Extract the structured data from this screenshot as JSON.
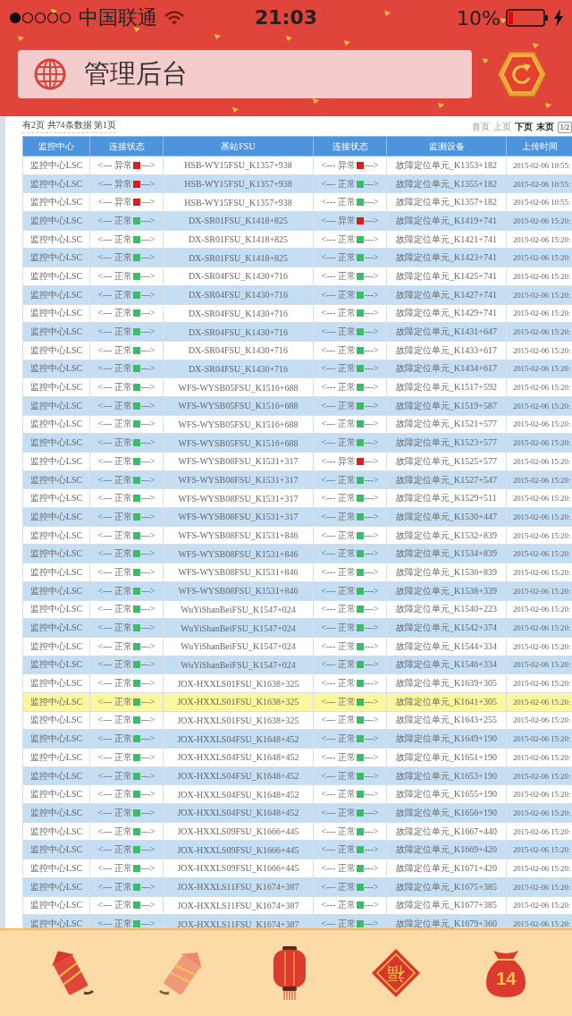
{
  "status_bar": {
    "carrier": "中国联通",
    "time": "21:03",
    "battery": "10%"
  },
  "header": {
    "title": "管理后台"
  },
  "pager": {
    "summary": "有2页 共74条数据 第1页",
    "links": [
      {
        "label": "首页",
        "disabled": true
      },
      {
        "label": "上页",
        "disabled": true
      },
      {
        "label": "下页",
        "disabled": false
      },
      {
        "label": "末页",
        "disabled": false
      }
    ],
    "page_box": "1/2"
  },
  "table": {
    "columns": [
      "监控中心",
      "连接状态",
      "基站FSU",
      "连接状态",
      "监测设备",
      "上传时间"
    ],
    "rows": [
      {
        "center": "监控中心LSC",
        "link_1": {
          "left": "<--- 异常",
          "alarm": true,
          "right": "--->"
        },
        "fsu": "HSB-WY15FSU_K1357+938",
        "link_2": {
          "left": "<--- 异常",
          "alarm": true,
          "right": "--->"
        },
        "device": "故障定位单元_K1353+182",
        "time": "2015-02-06 10:55:",
        "selected": false
      },
      {
        "center": "监控中心LSC",
        "link_1": {
          "left": "<--- 异常",
          "alarm": true,
          "right": "--->"
        },
        "fsu": "HSB-WY15FSU_K1357+938",
        "link_2": {
          "left": "<--- 正常",
          "alarm": false,
          "right": "--->"
        },
        "device": "故障定位单元_K1355+182",
        "time": "2015-02-06 10:55:",
        "selected": false
      },
      {
        "center": "监控中心LSC",
        "link_1": {
          "left": "<--- 异常",
          "alarm": true,
          "right": "--->"
        },
        "fsu": "HSB-WY15FSU_K1357+938",
        "link_2": {
          "left": "<--- 正常",
          "alarm": false,
          "right": "--->"
        },
        "device": "故障定位单元_K1357+182",
        "time": "2015-02-06 10:55:",
        "selected": false
      },
      {
        "center": "监控中心LSC",
        "link_1": {
          "left": "<--- 正常",
          "alarm": false,
          "right": "--->"
        },
        "fsu": "DX-SR01FSU_K1418+825",
        "link_2": {
          "left": "<--- 异常",
          "alarm": true,
          "right": "--->"
        },
        "device": "故障定位单元_K1419+741",
        "time": "2015-02-06 15:20:",
        "selected": false
      },
      {
        "center": "监控中心LSC",
        "link_1": {
          "left": "<--- 正常",
          "alarm": false,
          "right": "--->"
        },
        "fsu": "DX-SR01FSU_K1418+825",
        "link_2": {
          "left": "<--- 正常",
          "alarm": false,
          "right": "--->"
        },
        "device": "故障定位单元_K1421+741",
        "time": "2015-02-06 15:20:",
        "selected": false
      },
      {
        "center": "监控中心LSC",
        "link_1": {
          "left": "<--- 正常",
          "alarm": false,
          "right": "--->"
        },
        "fsu": "DX-SR01FSU_K1418+825",
        "link_2": {
          "left": "<--- 正常",
          "alarm": false,
          "right": "--->"
        },
        "device": "故障定位单元_K1423+741",
        "time": "2015-02-06 15:20:",
        "selected": false
      },
      {
        "center": "监控中心LSC",
        "link_1": {
          "left": "<--- 正常",
          "alarm": false,
          "right": "--->"
        },
        "fsu": "DX-SR04FSU_K1430+716",
        "link_2": {
          "left": "<--- 正常",
          "alarm": false,
          "right": "--->"
        },
        "device": "故障定位单元_K1425+741",
        "time": "2015-02-06 15:20:",
        "selected": false
      },
      {
        "center": "监控中心LSC",
        "link_1": {
          "left": "<--- 正常",
          "alarm": false,
          "right": "--->"
        },
        "fsu": "DX-SR04FSU_K1430+716",
        "link_2": {
          "left": "<--- 正常",
          "alarm": false,
          "right": "--->"
        },
        "device": "故障定位单元_K1427+741",
        "time": "2015-02-06 15:20:",
        "selected": false
      },
      {
        "center": "监控中心LSC",
        "link_1": {
          "left": "<--- 正常",
          "alarm": false,
          "right": "--->"
        },
        "fsu": "DX-SR04FSU_K1430+716",
        "link_2": {
          "left": "<--- 正常",
          "alarm": false,
          "right": "--->"
        },
        "device": "故障定位单元_K1429+741",
        "time": "2015-02-06 15:20:",
        "selected": false
      },
      {
        "center": "监控中心LSC",
        "link_1": {
          "left": "<--- 正常",
          "alarm": false,
          "right": "--->"
        },
        "fsu": "DX-SR04FSU_K1430+716",
        "link_2": {
          "left": "<--- 正常",
          "alarm": false,
          "right": "--->"
        },
        "device": "故障定位单元_K1431+647",
        "time": "2015-02-06 15:20:",
        "selected": false
      },
      {
        "center": "监控中心LSC",
        "link_1": {
          "left": "<--- 正常",
          "alarm": false,
          "right": "--->"
        },
        "fsu": "DX-SR04FSU_K1430+716",
        "link_2": {
          "left": "<--- 正常",
          "alarm": false,
          "right": "--->"
        },
        "device": "故障定位单元_K1433+617",
        "time": "2015-02-06 15:20:",
        "selected": false
      },
      {
        "center": "监控中心LSC",
        "link_1": {
          "left": "<--- 正常",
          "alarm": false,
          "right": "--->"
        },
        "fsu": "DX-SR04FSU_K1430+716",
        "link_2": {
          "left": "<--- 正常",
          "alarm": false,
          "right": "--->"
        },
        "device": "故障定位单元_K1434+617",
        "time": "2015-02-06 15:20:",
        "selected": false
      },
      {
        "center": "监控中心LSC",
        "link_1": {
          "left": "<--- 正常",
          "alarm": false,
          "right": "--->"
        },
        "fsu": "WFS-WYSB05FSU_K1516+688",
        "link_2": {
          "left": "<--- 正常",
          "alarm": false,
          "right": "--->"
        },
        "device": "故障定位单元_K1517+592",
        "time": "2015-02-06 15:20:",
        "selected": false
      },
      {
        "center": "监控中心LSC",
        "link_1": {
          "left": "<--- 正常",
          "alarm": false,
          "right": "--->"
        },
        "fsu": "WFS-WYSB05FSU_K1516+688",
        "link_2": {
          "left": "<--- 正常",
          "alarm": false,
          "right": "--->"
        },
        "device": "故障定位单元_K1519+587",
        "time": "2015-02-06 15:20:",
        "selected": false
      },
      {
        "center": "监控中心LSC",
        "link_1": {
          "left": "<--- 正常",
          "alarm": false,
          "right": "--->"
        },
        "fsu": "WFS-WYSB05FSU_K1516+688",
        "link_2": {
          "left": "<--- 正常",
          "alarm": false,
          "right": "--->"
        },
        "device": "故障定位单元_K1521+577",
        "time": "2015-02-06 15:20:",
        "selected": false
      },
      {
        "center": "监控中心LSC",
        "link_1": {
          "left": "<--- 正常",
          "alarm": false,
          "right": "--->"
        },
        "fsu": "WFS-WYSB05FSU_K1516+688",
        "link_2": {
          "left": "<--- 正常",
          "alarm": false,
          "right": "--->"
        },
        "device": "故障定位单元_K1523+577",
        "time": "2015-02-06 15:20:",
        "selected": false
      },
      {
        "center": "监控中心LSC",
        "link_1": {
          "left": "<--- 正常",
          "alarm": false,
          "right": "--->"
        },
        "fsu": "WFS-WYSB08FSU_K1531+317",
        "link_2": {
          "left": "<--- 异常",
          "alarm": true,
          "right": "--->"
        },
        "device": "故障定位单元_K1525+577",
        "time": "2015-02-06 15:20:",
        "selected": false
      },
      {
        "center": "监控中心LSC",
        "link_1": {
          "left": "<--- 正常",
          "alarm": false,
          "right": "--->"
        },
        "fsu": "WFS-WYSB08FSU_K1531+317",
        "link_2": {
          "left": "<--- 正常",
          "alarm": false,
          "right": "--->"
        },
        "device": "故障定位单元_K1527+547",
        "time": "2015-02-06 15:20:",
        "selected": false
      },
      {
        "center": "监控中心LSC",
        "link_1": {
          "left": "<--- 正常",
          "alarm": false,
          "right": "--->"
        },
        "fsu": "WFS-WYSB08FSU_K1531+317",
        "link_2": {
          "left": "<--- 正常",
          "alarm": false,
          "right": "--->"
        },
        "device": "故障定位单元_K1529+511",
        "time": "2015-02-06 15:20:",
        "selected": false
      },
      {
        "center": "监控中心LSC",
        "link_1": {
          "left": "<--- 正常",
          "alarm": false,
          "right": "--->"
        },
        "fsu": "WFS-WYSB08FSU_K1531+317",
        "link_2": {
          "left": "<--- 正常",
          "alarm": false,
          "right": "--->"
        },
        "device": "故障定位单元_K1530+447",
        "time": "2015-02-06 15:20:",
        "selected": false
      },
      {
        "center": "监控中心LSC",
        "link_1": {
          "left": "<--- 正常",
          "alarm": false,
          "right": "--->"
        },
        "fsu": "WFS-WYSB08FSU_K1531+846",
        "link_2": {
          "left": "<--- 正常",
          "alarm": false,
          "right": "--->"
        },
        "device": "故障定位单元_K1532+839",
        "time": "2015-02-06 15:20:",
        "selected": false
      },
      {
        "center": "监控中心LSC",
        "link_1": {
          "left": "<--- 正常",
          "alarm": false,
          "right": "--->"
        },
        "fsu": "WFS-WYSB08FSU_K1531+846",
        "link_2": {
          "left": "<--- 正常",
          "alarm": false,
          "right": "--->"
        },
        "device": "故障定位单元_K1534+839",
        "time": "2015-02-06 15:20:",
        "selected": false
      },
      {
        "center": "监控中心LSC",
        "link_1": {
          "left": "<--- 正常",
          "alarm": false,
          "right": "--->"
        },
        "fsu": "WFS-WYSB08FSU_K1531+846",
        "link_2": {
          "left": "<--- 正常",
          "alarm": false,
          "right": "--->"
        },
        "device": "故障定位单元_K1536+839",
        "time": "2015-02-06 15:20:",
        "selected": false
      },
      {
        "center": "监控中心LSC",
        "link_1": {
          "left": "<--- 正常",
          "alarm": false,
          "right": "--->"
        },
        "fsu": "WFS-WYSB08FSU_K1531+846",
        "link_2": {
          "left": "<--- 正常",
          "alarm": false,
          "right": "--->"
        },
        "device": "故障定位单元_K1538+339",
        "time": "2015-02-06 15:20:",
        "selected": false
      },
      {
        "center": "监控中心LSC",
        "link_1": {
          "left": "<--- 正常",
          "alarm": false,
          "right": "--->"
        },
        "fsu": "WuYiShanBeiFSU_K1547+024",
        "link_2": {
          "left": "<--- 正常",
          "alarm": false,
          "right": "--->"
        },
        "device": "故障定位单元_K1540+223",
        "time": "2015-02-06 15:20:",
        "selected": false
      },
      {
        "center": "监控中心LSC",
        "link_1": {
          "left": "<--- 正常",
          "alarm": false,
          "right": "--->"
        },
        "fsu": "WuYiShanBeiFSU_K1547+024",
        "link_2": {
          "left": "<--- 正常",
          "alarm": false,
          "right": "--->"
        },
        "device": "故障定位单元_K1542+374",
        "time": "2015-02-06 15:20:",
        "selected": false
      },
      {
        "center": "监控中心LSC",
        "link_1": {
          "left": "<--- 正常",
          "alarm": false,
          "right": "--->"
        },
        "fsu": "WuYiShanBeiFSU_K1547+024",
        "link_2": {
          "left": "<--- 正常",
          "alarm": false,
          "right": "--->"
        },
        "device": "故障定位单元_K1544+334",
        "time": "2015-02-06 15:20:",
        "selected": false
      },
      {
        "center": "监控中心LSC",
        "link_1": {
          "left": "<--- 正常",
          "alarm": false,
          "right": "--->"
        },
        "fsu": "WuYiShanBeiFSU_K1547+024",
        "link_2": {
          "left": "<--- 正常",
          "alarm": false,
          "right": "--->"
        },
        "device": "故障定位单元_K1546+334",
        "time": "2015-02-06 15:20:",
        "selected": false
      },
      {
        "center": "监控中心LSC",
        "link_1": {
          "left": "<--- 正常",
          "alarm": false,
          "right": "--->"
        },
        "fsu": "JOX-HXXLS01FSU_K1638+325",
        "link_2": {
          "left": "<--- 正常",
          "alarm": false,
          "right": "--->"
        },
        "device": "故障定位单元_K1639+305",
        "time": "2015-02-06 15:20:",
        "selected": false
      },
      {
        "center": "监控中心LSC",
        "link_1": {
          "left": "<--- 正常",
          "alarm": false,
          "right": "--->"
        },
        "fsu": "JOX-HXXLS01FSU_K1638+325",
        "link_2": {
          "left": "<--- 正常",
          "alarm": false,
          "right": "--->"
        },
        "device": "故障定位单元_K1641+305",
        "time": "2015-02-06 15:20:",
        "selected": true
      },
      {
        "center": "监控中心LSC",
        "link_1": {
          "left": "<--- 正常",
          "alarm": false,
          "right": "--->"
        },
        "fsu": "JOX-HXXLS01FSU_K1638+325",
        "link_2": {
          "left": "<--- 正常",
          "alarm": false,
          "right": "--->"
        },
        "device": "故障定位单元_K1643+255",
        "time": "2015-02-06 15:20:",
        "selected": false
      },
      {
        "center": "监控中心LSC",
        "link_1": {
          "left": "<--- 正常",
          "alarm": false,
          "right": "--->"
        },
        "fsu": "JOX-HXXLS04FSU_K1648+452",
        "link_2": {
          "left": "<--- 正常",
          "alarm": false,
          "right": "--->"
        },
        "device": "故障定位单元_K1649+190",
        "time": "2015-02-06 15:20:",
        "selected": false
      },
      {
        "center": "监控中心LSC",
        "link_1": {
          "left": "<--- 正常",
          "alarm": false,
          "right": "--->"
        },
        "fsu": "JOX-HXXLS04FSU_K1648+452",
        "link_2": {
          "left": "<--- 正常",
          "alarm": false,
          "right": "--->"
        },
        "device": "故障定位单元_K1651+190",
        "time": "2015-02-06 15:20:",
        "selected": false
      },
      {
        "center": "监控中心LSC",
        "link_1": {
          "left": "<--- 正常",
          "alarm": false,
          "right": "--->"
        },
        "fsu": "JOX-HXXLS04FSU_K1648+452",
        "link_2": {
          "left": "<--- 正常",
          "alarm": false,
          "right": "--->"
        },
        "device": "故障定位单元_K1653+190",
        "time": "2015-02-06 15:20:",
        "selected": false
      },
      {
        "center": "监控中心LSC",
        "link_1": {
          "left": "<--- 正常",
          "alarm": false,
          "right": "--->"
        },
        "fsu": "JOX-HXXLS04FSU_K1648+452",
        "link_2": {
          "left": "<--- 正常",
          "alarm": false,
          "right": "--->"
        },
        "device": "故障定位单元_K1655+190",
        "time": "2015-02-06 15:20:",
        "selected": false
      },
      {
        "center": "监控中心LSC",
        "link_1": {
          "left": "<--- 正常",
          "alarm": false,
          "right": "--->"
        },
        "fsu": "JOX-HXXLS04FSU_K1648+452",
        "link_2": {
          "left": "<--- 正常",
          "alarm": false,
          "right": "--->"
        },
        "device": "故障定位单元_K1656+190",
        "time": "2015-02-06 15:20:",
        "selected": false
      },
      {
        "center": "监控中心LSC",
        "link_1": {
          "left": "<--- 正常",
          "alarm": false,
          "right": "--->"
        },
        "fsu": "JOX-HXXLS09FSU_K1666+445",
        "link_2": {
          "left": "<--- 正常",
          "alarm": false,
          "right": "--->"
        },
        "device": "故障定位单元_K1667+440",
        "time": "2015-02-06 15:20:",
        "selected": false
      },
      {
        "center": "监控中心LSC",
        "link_1": {
          "left": "<--- 正常",
          "alarm": false,
          "right": "--->"
        },
        "fsu": "JOX-HXXLS09FSU_K1666+445",
        "link_2": {
          "left": "<--- 正常",
          "alarm": false,
          "right": "--->"
        },
        "device": "故障定位单元_K1669+420",
        "time": "2015-02-06 15:20:",
        "selected": false
      },
      {
        "center": "监控中心LSC",
        "link_1": {
          "left": "<--- 正常",
          "alarm": false,
          "right": "--->"
        },
        "fsu": "JOX-HXXLS09FSU_K1666+445",
        "link_2": {
          "left": "<--- 正常",
          "alarm": false,
          "right": "--->"
        },
        "device": "故障定位单元_K1671+420",
        "time": "2015-02-06 15:20:",
        "selected": false
      },
      {
        "center": "监控中心LSC",
        "link_1": {
          "left": "<--- 正常",
          "alarm": false,
          "right": "--->"
        },
        "fsu": "JOX-HXXLS11FSU_K1674+387",
        "link_2": {
          "left": "<--- 正常",
          "alarm": false,
          "right": "--->"
        },
        "device": "故障定位单元_K1675+385",
        "time": "2015-02-06 15:20:",
        "selected": false
      },
      {
        "center": "监控中心LSC",
        "link_1": {
          "left": "<--- 正常",
          "alarm": false,
          "right": "--->"
        },
        "fsu": "JOX-HXXLS11FSU_K1674+387",
        "link_2": {
          "left": "<--- 正常",
          "alarm": false,
          "right": "--->"
        },
        "device": "故障定位单元_K1677+385",
        "time": "2015-02-06 15:20:",
        "selected": false
      },
      {
        "center": "监控中心LSC",
        "link_1": {
          "left": "<--- 正常",
          "alarm": false,
          "right": "--->"
        },
        "fsu": "JOX-HXXLS11FSU_K1674+387",
        "link_2": {
          "left": "<--- 正常",
          "alarm": false,
          "right": "--->"
        },
        "device": "故障定位单元_K1679+360",
        "time": "2015-02-06 15:20:",
        "selected": false
      }
    ]
  },
  "tab_bar": [
    {
      "kind": "firecracker"
    },
    {
      "kind": "rocket"
    },
    {
      "kind": "lantern"
    },
    {
      "kind": "fu",
      "label": "福"
    },
    {
      "kind": "bag",
      "label": "14"
    }
  ]
}
